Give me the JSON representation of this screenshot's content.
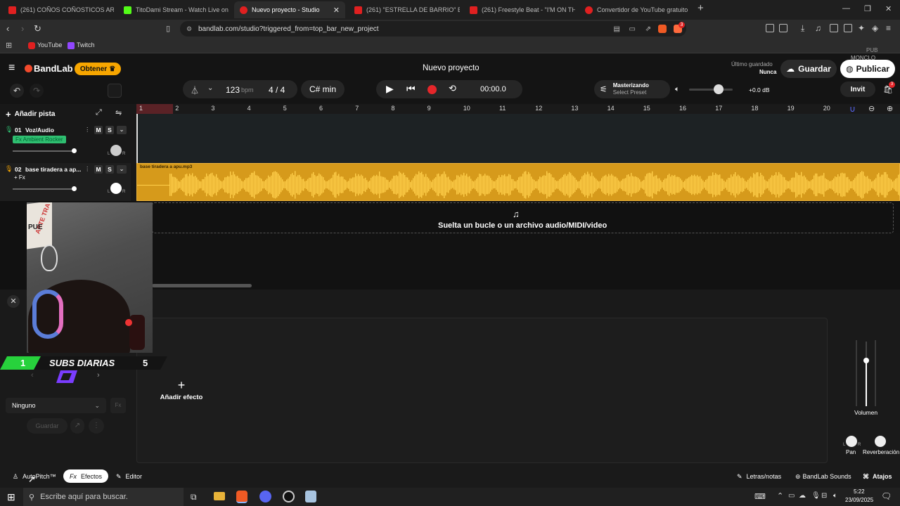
{
  "browser": {
    "tabs": [
      {
        "label": "(261) COÑOS COÑOSTICOS ARISTO",
        "color": "#e02020"
      },
      {
        "label": "TitoDami Stream - Watch Live on Kic",
        "color": "#53fc18"
      },
      {
        "label": "Nuevo proyecto - Studio",
        "color": "#e02020"
      },
      {
        "label": "(261) \"ESTRELLA DE BARRIO\" Base de",
        "color": "#e02020"
      },
      {
        "label": "(261) Freestyle Beat - \"I'M ON THIS H",
        "color": "#e02020"
      },
      {
        "label": "Convertidor de YouTube gratuito a M",
        "color": "#e02020"
      }
    ],
    "url": "bandlab.com/studio?triggered_from=top_bar_new_project",
    "bookmarks": [
      "YouTube",
      "Twitch"
    ],
    "ext_badge": "3"
  },
  "header": {
    "logo": "BandLab",
    "obtener": "Obtener",
    "project_title": "Nuevo proyecto",
    "last_saved_label": "Último guardado",
    "last_saved_value": "Nunca",
    "save": "Guardar",
    "publish": "Publicar",
    "invite": "Invit",
    "cart_badge": "3",
    "overlay_text": "PUB",
    "overlay_text2": "MONCLO"
  },
  "transport": {
    "bpm": "123",
    "bpm_unit": "bpm",
    "time_sig": "4 / 4",
    "key": "C# min",
    "time": "00:00.0",
    "master_label": "Masterizando",
    "master_preset": "Select Preset",
    "db": "+0.0 dB"
  },
  "ruler": [
    "1",
    "2",
    "3",
    "4",
    "5",
    "6",
    "7",
    "8",
    "9",
    "10",
    "11",
    "12",
    "13",
    "14",
    "15",
    "16",
    "17",
    "18",
    "19",
    "20"
  ],
  "tracks": {
    "add": "Añadir pista",
    "items": [
      {
        "num": "01",
        "name": "Voz/Audio",
        "fx": "Fx Ambient Rocker",
        "m": "M",
        "s": "S",
        "l": "L",
        "r": "R"
      },
      {
        "num": "02",
        "name": "base tiradera a ap...",
        "fx": "+ Fx",
        "m": "M",
        "s": "S",
        "l": "L",
        "r": "R"
      }
    ],
    "clip_name": "base tiradera a apu.mp3",
    "drop_text": "Suelta un bucle o un archivo audio/MIDI/video"
  },
  "overlay": {
    "subs_count": "1",
    "subs_label": "SUBS DIARIAS",
    "subs_goal": "5",
    "cam_text1": "ARTE TRA",
    "cam_text2": "PUE"
  },
  "effects": {
    "preset": "Ninguno",
    "preset_btn": "Fx",
    "save": "Guardar",
    "add_effect": "Añadir efecto",
    "volume": "Volumen",
    "pan": "Pan",
    "reverb": "Reverberación",
    "l": "L",
    "r": "R"
  },
  "bottom": {
    "autopitch": "AutoPitch™",
    "fx_prefix": "Fx",
    "effects": "Efectos",
    "editor": "Editor",
    "lyrics": "Letras/notas",
    "sounds": "BandLab Sounds",
    "shortcuts": "Atajos"
  },
  "taskbar": {
    "search_placeholder": "Escribe aquí para buscar.",
    "time": "5:22",
    "date": "23/09/2025"
  },
  "colors": {
    "accent_orange": "#f7a600",
    "waveform": "#f0b21f",
    "record": "#e5262a",
    "fx_green": "#2fbf71"
  }
}
